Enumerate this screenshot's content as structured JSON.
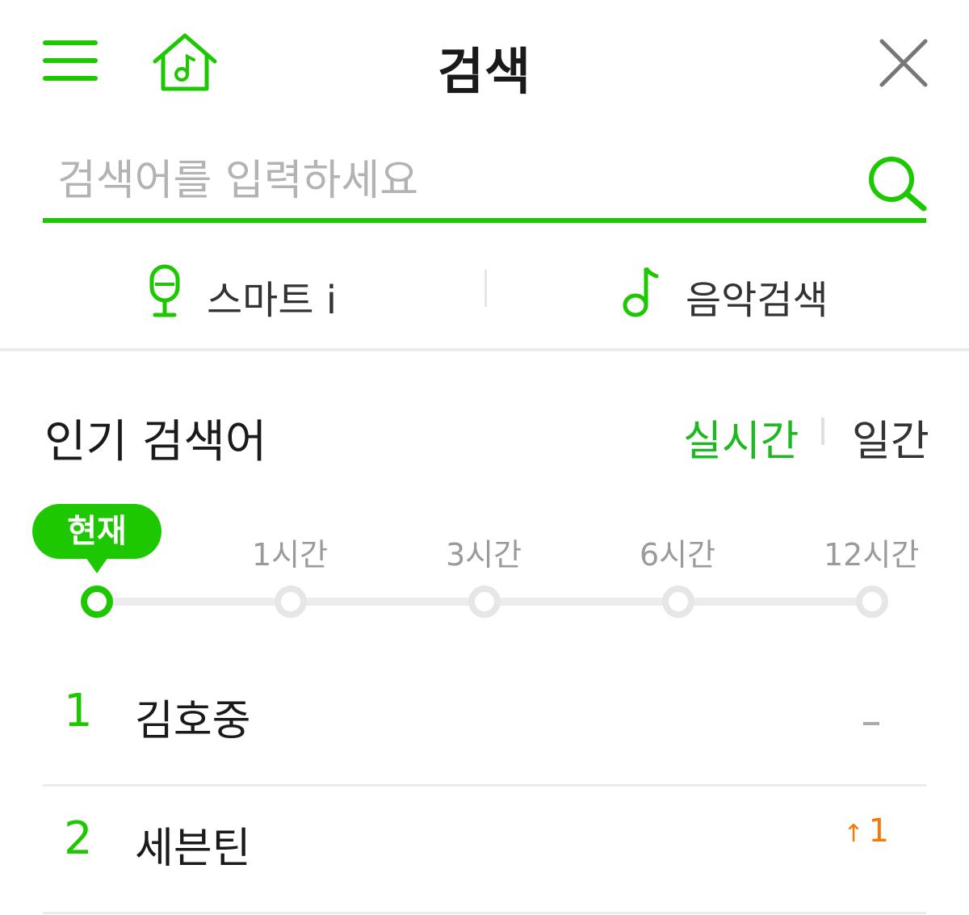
{
  "header": {
    "title": "검색",
    "menu_icon": "hamburger-menu-icon",
    "home_icon": "music-home-icon",
    "close_icon": "close-icon"
  },
  "search": {
    "placeholder": "검색어를 입력하세요",
    "value": "",
    "search_icon": "search-icon"
  },
  "quick_links": [
    {
      "label": "스마트 i",
      "icon": "microphone-icon"
    },
    {
      "label": "음악검색",
      "icon": "music-note-icon"
    }
  ],
  "popular": {
    "title": "인기 검색어",
    "modes": [
      {
        "label": "실시간",
        "active": true
      },
      {
        "label": "일간",
        "active": false
      }
    ],
    "timeline": [
      {
        "label": "현재",
        "active": true
      },
      {
        "label": "1시간",
        "active": false
      },
      {
        "label": "3시간",
        "active": false
      },
      {
        "label": "6시간",
        "active": false
      },
      {
        "label": "12시간",
        "active": false
      }
    ],
    "ranking": [
      {
        "rank": "1",
        "keyword": "김호중",
        "change": "–",
        "change_type": "none"
      },
      {
        "rank": "2",
        "keyword": "세븐틴",
        "change": "1",
        "change_type": "up"
      }
    ]
  },
  "colors": {
    "brand_green": "#1ec800",
    "text_green": "#1eb820",
    "up_orange": "#f07a0a",
    "muted_gray": "#9a9a9a"
  }
}
